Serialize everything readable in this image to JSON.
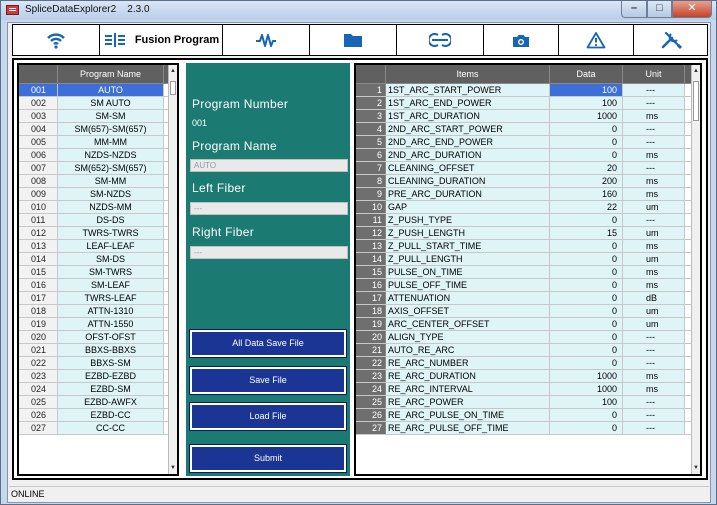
{
  "window": {
    "title": "SpliceDataExplorer2    2.3.0",
    "controls": [
      "minimize",
      "maximize",
      "close"
    ]
  },
  "toolbar": {
    "buttons": [
      {
        "id": "wifi",
        "icon": "wifi-icon"
      },
      {
        "id": "fusion",
        "icon": "fusion-program-icon",
        "label": "Fusion Program"
      },
      {
        "id": "arc",
        "icon": "arc-wave-icon"
      },
      {
        "id": "folder",
        "icon": "folder-icon"
      },
      {
        "id": "splice",
        "icon": "splice-icon"
      },
      {
        "id": "camera",
        "icon": "camera-icon"
      },
      {
        "id": "warning",
        "icon": "warning-icon"
      },
      {
        "id": "tools",
        "icon": "tools-icon"
      }
    ]
  },
  "programs": {
    "header": "Program Name",
    "selected_index": 0,
    "rows": [
      {
        "no": "001",
        "name": "AUTO"
      },
      {
        "no": "002",
        "name": "SM AUTO"
      },
      {
        "no": "003",
        "name": "SM-SM"
      },
      {
        "no": "004",
        "name": "SM(657)-SM(657)"
      },
      {
        "no": "005",
        "name": "MM-MM"
      },
      {
        "no": "006",
        "name": "NZDS-NZDS"
      },
      {
        "no": "007",
        "name": "SM(652)-SM(657)"
      },
      {
        "no": "008",
        "name": "SM-MM"
      },
      {
        "no": "009",
        "name": "SM-NZDS"
      },
      {
        "no": "010",
        "name": "NZDS-MM"
      },
      {
        "no": "011",
        "name": "DS-DS"
      },
      {
        "no": "012",
        "name": "TWRS-TWRS"
      },
      {
        "no": "013",
        "name": "LEAF-LEAF"
      },
      {
        "no": "014",
        "name": "SM-DS"
      },
      {
        "no": "015",
        "name": "SM-TWRS"
      },
      {
        "no": "016",
        "name": "SM-LEAF"
      },
      {
        "no": "017",
        "name": "TWRS-LEAF"
      },
      {
        "no": "018",
        "name": "ATTN-1310"
      },
      {
        "no": "019",
        "name": "ATTN-1550"
      },
      {
        "no": "020",
        "name": "OFST-OFST"
      },
      {
        "no": "021",
        "name": "BBXS-BBXS"
      },
      {
        "no": "022",
        "name": "BBXS-SM"
      },
      {
        "no": "023",
        "name": "EZBD-EZBD"
      },
      {
        "no": "024",
        "name": "EZBD-SM"
      },
      {
        "no": "025",
        "name": "EZBD-AWFX"
      },
      {
        "no": "026",
        "name": "EZBD-CC"
      },
      {
        "no": "027",
        "name": "CC-CC"
      }
    ]
  },
  "detail": {
    "program_number_label": "Program Number",
    "program_number": "001",
    "program_name_label": "Program Name",
    "program_name_value": "AUTO",
    "left_fiber_label": "Left Fiber",
    "left_fiber_value": "---",
    "right_fiber_label": "Right Fiber",
    "right_fiber_value": "---",
    "buttons": {
      "all_data_save": "All Data Save File",
      "save": "Save File",
      "load": "Load File",
      "submit": "Submit"
    }
  },
  "items": {
    "headers": {
      "items": "Items",
      "data": "Data",
      "unit": "Unit"
    },
    "highlight_index": 0,
    "rows": [
      {
        "no": "1",
        "item": "1ST_ARC_START_POWER",
        "data": "100",
        "unit": "---"
      },
      {
        "no": "2",
        "item": "1ST_ARC_END_POWER",
        "data": "100",
        "unit": "---"
      },
      {
        "no": "3",
        "item": "1ST_ARC_DURATION",
        "data": "1000",
        "unit": "ms"
      },
      {
        "no": "4",
        "item": "2ND_ARC_START_POWER",
        "data": "0",
        "unit": "---"
      },
      {
        "no": "5",
        "item": "2ND_ARC_END_POWER",
        "data": "0",
        "unit": "---"
      },
      {
        "no": "6",
        "item": "2ND_ARC_DURATION",
        "data": "0",
        "unit": "ms"
      },
      {
        "no": "7",
        "item": "CLEANING_OFFSET",
        "data": "20",
        "unit": "---"
      },
      {
        "no": "8",
        "item": "CLEANING_DURATION",
        "data": "200",
        "unit": "ms"
      },
      {
        "no": "9",
        "item": "PRE_ARC_DURATION",
        "data": "160",
        "unit": "ms"
      },
      {
        "no": "10",
        "item": "GAP",
        "data": "22",
        "unit": "um"
      },
      {
        "no": "11",
        "item": "Z_PUSH_TYPE",
        "data": "0",
        "unit": "---"
      },
      {
        "no": "12",
        "item": "Z_PUSH_LENGTH",
        "data": "15",
        "unit": "um"
      },
      {
        "no": "13",
        "item": "Z_PULL_START_TIME",
        "data": "0",
        "unit": "ms"
      },
      {
        "no": "14",
        "item": "Z_PULL_LENGTH",
        "data": "0",
        "unit": "um"
      },
      {
        "no": "15",
        "item": "PULSE_ON_TIME",
        "data": "0",
        "unit": "ms"
      },
      {
        "no": "16",
        "item": "PULSE_OFF_TIME",
        "data": "0",
        "unit": "ms"
      },
      {
        "no": "17",
        "item": "ATTENUATION",
        "data": "0",
        "unit": "dB"
      },
      {
        "no": "18",
        "item": "AXIS_OFFSET",
        "data": "0",
        "unit": "um"
      },
      {
        "no": "19",
        "item": "ARC_CENTER_OFFSET",
        "data": "0",
        "unit": "um"
      },
      {
        "no": "20",
        "item": "ALIGN_TYPE",
        "data": "0",
        "unit": "---"
      },
      {
        "no": "21",
        "item": "AUTO_RE_ARC",
        "data": "0",
        "unit": "---"
      },
      {
        "no": "22",
        "item": "RE_ARC_NUMBER",
        "data": "0",
        "unit": "---"
      },
      {
        "no": "23",
        "item": "RE_ARC_DURATION",
        "data": "1000",
        "unit": "ms"
      },
      {
        "no": "24",
        "item": "RE_ARC_INTERVAL",
        "data": "1000",
        "unit": "ms"
      },
      {
        "no": "25",
        "item": "RE_ARC_POWER",
        "data": "100",
        "unit": "---"
      },
      {
        "no": "26",
        "item": "RE_ARC_PULSE_ON_TIME",
        "data": "0",
        "unit": "---"
      },
      {
        "no": "27",
        "item": "RE_ARC_PULSE_OFF_TIME",
        "data": "0",
        "unit": "---"
      }
    ]
  },
  "status": {
    "text": "ONLINE"
  },
  "colors": {
    "teal_panel": "#1b7a72",
    "button_navy": "#1a3594",
    "selection": "#3d6fd8",
    "cell_bg": "#dff4f7",
    "header_gray": "#606060"
  }
}
